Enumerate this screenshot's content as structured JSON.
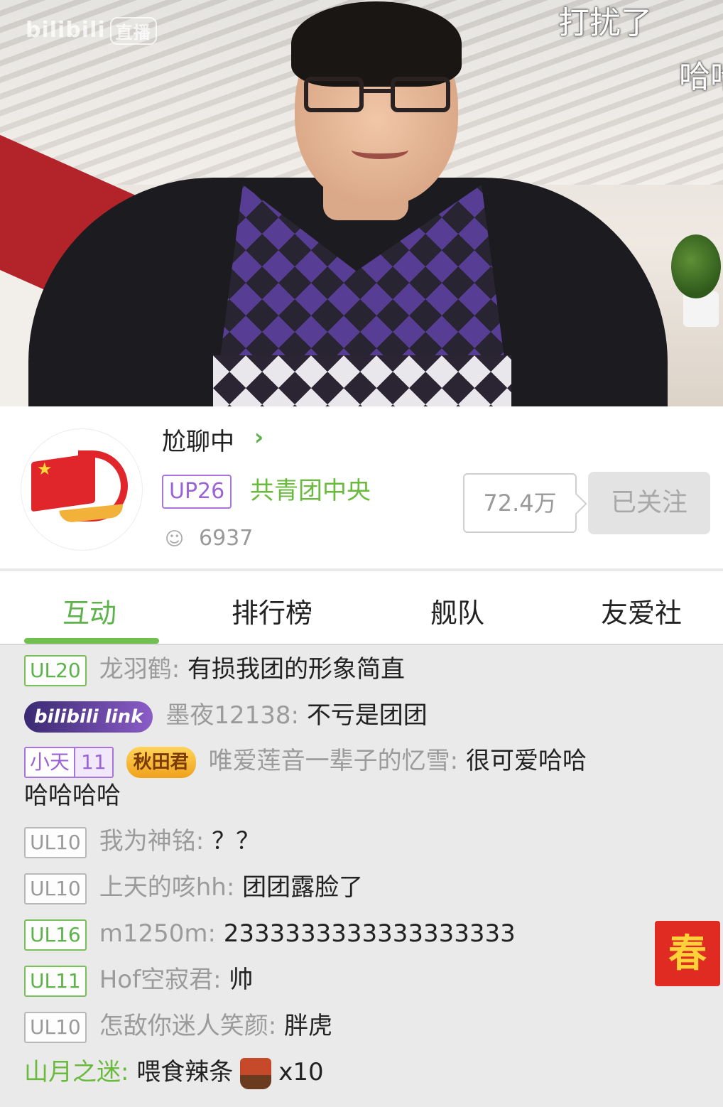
{
  "video": {
    "watermark_brand": "bilibili",
    "watermark_live": "直播",
    "danmaku": [
      "打扰了",
      "哈哈"
    ]
  },
  "room": {
    "title": "尬聊中",
    "up_badge": "UP26",
    "anchor_name": "共青团中央",
    "online_count": "6937",
    "fans_count": "72.4万",
    "follow_label": "已关注",
    "accent_color": "#5db34a"
  },
  "tabs": [
    {
      "label": "互动",
      "active": true
    },
    {
      "label": "排行榜"
    },
    {
      "label": "舰队"
    },
    {
      "label": "友爱社"
    }
  ],
  "chat": [
    {
      "badge": "UL20",
      "user": "龙羽鹤:",
      "text": "有损我团的形象简直"
    },
    {
      "badge_special": "bilibili link",
      "user": "墨夜12138:",
      "text": "不亏是团团"
    },
    {
      "medal_name": "小天",
      "medal_level": "11",
      "title_badge": "秋田君",
      "user": "唯爱莲音一辈子的忆雪:",
      "text": "很可爱哈哈",
      "text_cont": "哈哈哈哈"
    },
    {
      "badge": "UL10",
      "user": "我为神铭:",
      "text": "？？"
    },
    {
      "badge": "UL10",
      "user": "上天的咳hh:",
      "text": "团团露脸了"
    },
    {
      "badge": "UL16",
      "user": "m1250m:",
      "text": "2333333333333333333"
    },
    {
      "badge": "UL11",
      "user": "Hof空寂君:",
      "text": "帅"
    },
    {
      "badge": "UL10",
      "user": "怎敌你迷人笑颜:",
      "text": "胖虎"
    }
  ],
  "gift": {
    "user": "山月之迷:",
    "action": "喂食辣条",
    "count": "x10"
  },
  "spring_button": "春"
}
